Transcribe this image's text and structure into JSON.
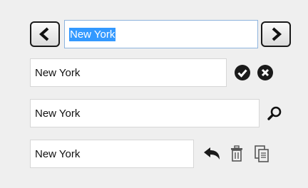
{
  "row1": {
    "value": "New York",
    "prev_icon": "chevron-left-icon",
    "next_icon": "chevron-right-icon"
  },
  "row2": {
    "value": "New York",
    "confirm_icon": "check-circle-icon",
    "cancel_icon": "close-circle-icon"
  },
  "row3": {
    "value": "New York",
    "search_icon": "search-icon"
  },
  "row4": {
    "value": "New York",
    "undo_icon": "undo-icon",
    "delete_icon": "trash-icon",
    "copy_icon": "copy-icon"
  }
}
